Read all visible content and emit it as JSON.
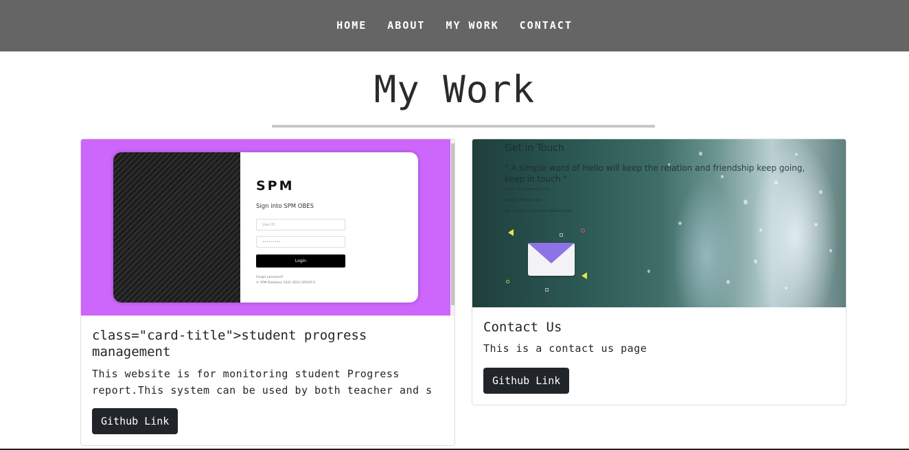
{
  "nav": {
    "items": [
      {
        "label": "HOME"
      },
      {
        "label": "ABOUT"
      },
      {
        "label": "MY WORK"
      },
      {
        "label": "CONTACT"
      }
    ]
  },
  "page": {
    "title": "My Work"
  },
  "cards": [
    {
      "image": {
        "brand": "SPM",
        "subtitle": "Sign into SPM OBES",
        "user_placeholder": "User ID",
        "pass_placeholder": "•••••••••",
        "login_label": "Login",
        "forgot": "Forgot password?",
        "footer": "© SPM Database 2021 SE10 GROUP 6"
      },
      "title": "class=\"card-title\">student progress management",
      "text": "This website is for monitoring student Progress report.This system can be used by both teacher and s",
      "button": "Github Link"
    },
    {
      "image": {
        "heading": "Get in Touch",
        "line": "\" A simple word of Hello will keep the relation and friendship keep going, keep in touch \"",
        "email": "Email: info@example.com",
        "phone": "Phone: +94xxxxxxxx",
        "note": "You can give us feedback details below"
      },
      "title": "Contact Us",
      "text": "This is a contact us page",
      "button": "Github Link"
    }
  ],
  "colors": {
    "navbar": "#656565",
    "button": "#212529",
    "card_left_bg": "#cd66fb",
    "envelope_flap": "#8e73e6"
  }
}
